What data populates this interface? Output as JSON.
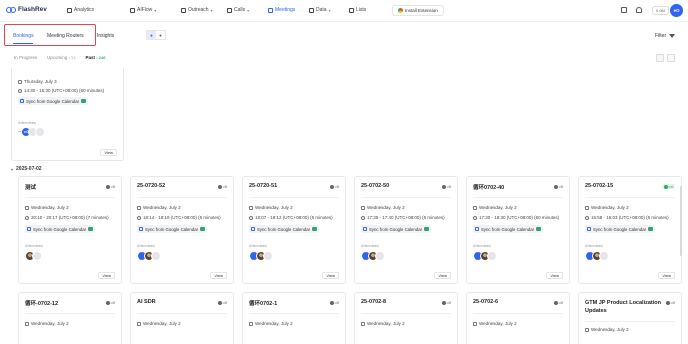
{
  "app": {
    "name": "FlashRev"
  },
  "nav": [
    {
      "label": "Analytics",
      "dropdown": false
    },
    {
      "label": "AIFlow",
      "dropdown": true
    },
    {
      "label": "Outreach",
      "dropdown": true
    },
    {
      "label": "Calls",
      "dropdown": true
    },
    {
      "label": "Meetings",
      "dropdown": false,
      "active": true
    },
    {
      "label": "Data",
      "dropdown": true
    },
    {
      "label": "Lists",
      "dropdown": false
    }
  ],
  "header": {
    "install_label": "Install Extension",
    "credits": "0.0M",
    "avatar": "eO"
  },
  "tabs": [
    {
      "label": "Bookings",
      "active": true
    },
    {
      "label": "Meeting Routers"
    },
    {
      "label": "Insights"
    }
  ],
  "filter_label": "Filter",
  "subtabs": [
    {
      "label": "In Progress",
      "count": ""
    },
    {
      "label": "Upcoming",
      "count": "• 13"
    },
    {
      "label": "Past",
      "count": "• 246",
      "active": true
    }
  ],
  "top_card": {
    "date": "Thursday, July 3",
    "time": "14:30 - 15:30 (UTC+08:00) (60 minutes)",
    "sync": "Sync from Google Calendar",
    "attendees_label": "Attendees",
    "dash": "--",
    "avatar": "eO",
    "view": "View"
  },
  "date_group": "2025-07-02",
  "cards_row1": [
    {
      "title": "测试",
      "status": "off",
      "date": "Wednesday, July 2",
      "time": "20:10 - 20:17 (UTC+08:00) (7 minutes)",
      "sync": "Sync from Google Calendar",
      "attendees": "Attendees",
      "view": "View"
    },
    {
      "title": "25-0720-52",
      "status": "off",
      "date": "Wednesday, July 2",
      "time": "18:14 - 18:19 (UTC+08:00) (5 minutes)",
      "sync": "Sync from Google Calendar",
      "attendees": "Attendees",
      "view": "View"
    },
    {
      "title": "25-0720-51",
      "status": "off",
      "date": "Wednesday, July 2",
      "time": "18:07 - 18:12 (UTC+08:00) (5 minutes)",
      "sync": "Sync from Google Calendar",
      "attendees": "Attendees",
      "view": "View"
    },
    {
      "title": "25-0702-50",
      "status": "off",
      "date": "Wednesday, July 2",
      "time": "17:35 - 17:40 (UTC+08:00) (5 minutes)",
      "sync": "Sync from Google Calendar",
      "attendees": "Attendees",
      "view": "View"
    },
    {
      "title": "循环0702-40",
      "status": "off",
      "date": "Wednesday, July 2",
      "time": "17:30 - 18:30 (UTC+08:00) (60 minutes)",
      "sync": "Sync from Google Calendar",
      "attendees": "Attendees",
      "view": "View"
    },
    {
      "title": "25-0702-15",
      "status": "on",
      "date": "Wednesday, July 2",
      "time": "15:58 - 16:03 (UTC+08:00) (5 minutes)",
      "sync": "Sync from Google Calendar",
      "attendees": "Attendees",
      "view": "View"
    }
  ],
  "cards_row2": [
    {
      "title": "循环-0702-12",
      "status": "off",
      "date": "Wednesday, July 2"
    },
    {
      "title": "AI SDR",
      "status": "off",
      "date": "Wednesday, July 2"
    },
    {
      "title": "循环0702-1",
      "status": "off",
      "date": "Wednesday, July 2"
    },
    {
      "title": "25-0702-8",
      "status": "off",
      "date": "Wednesday, July 2"
    },
    {
      "title": "25-0702-6",
      "status": "off",
      "date": "Wednesday, July 2"
    },
    {
      "title": "GTM JP Product Localization Updates",
      "status": "off",
      "date": "Wednesday, July 2"
    }
  ],
  "colors": {
    "accent": "#2f63f0",
    "highlight": "#e0474c",
    "on_green": "#2fa86b"
  }
}
